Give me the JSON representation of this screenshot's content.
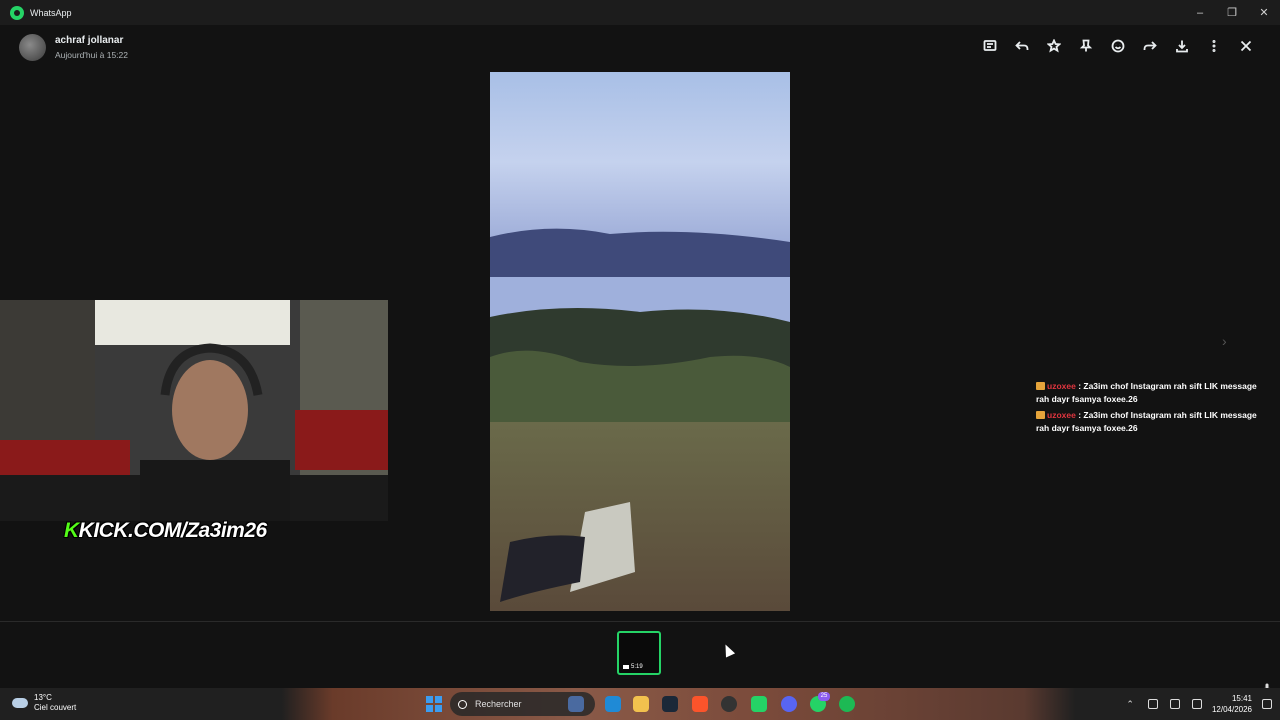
{
  "window": {
    "app_title": "WhatsApp",
    "controls": [
      "minimize-icon",
      "restore-icon",
      "close-icon"
    ]
  },
  "header": {
    "sender_name": "achraf jollanar",
    "timestamp": "Aujourd'hui à 15:22"
  },
  "toolbar": {
    "icons": [
      "chat-icon",
      "reply-icon",
      "star-icon",
      "pin-icon",
      "emoji-icon",
      "forward-icon",
      "download-icon",
      "more-icon",
      "close-icon"
    ]
  },
  "stream_overlay": {
    "kick_prefix": "K",
    "kick_text": "KICK.COM/Za3im26"
  },
  "chat": [
    {
      "user": "uzoxee",
      "separator": " : ",
      "text": "Za3im chof Instagram rah sift LIK message rah dayr fsamya foxee.26"
    },
    {
      "user": "uzoxee",
      "separator": " : ",
      "text": "Za3im chof Instagram rah sift LIK message rah dayr fsamya foxee.26"
    }
  ],
  "thumbnail": {
    "duration": "5:19"
  },
  "taskbar": {
    "temperature": "13°C",
    "weather": "Ciel couvert",
    "search_placeholder": "Rechercher",
    "badge_discord": "",
    "badge_whatsapp": "25",
    "time": "15:41",
    "date": "12/04/2026"
  },
  "colors": {
    "accent": "#25d366",
    "background": "#121212",
    "chat_user": "#e0353f",
    "kick_green": "#53fc18"
  }
}
